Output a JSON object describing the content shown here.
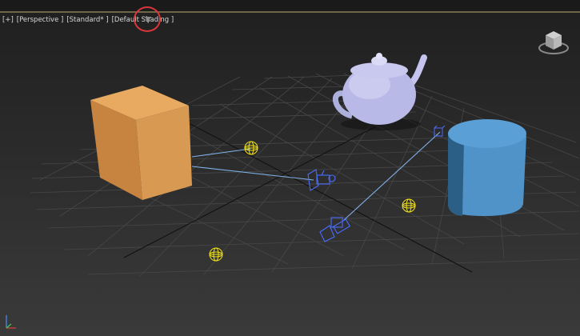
{
  "viewport": {
    "labels": {
      "menu": "[+]",
      "view": "[Perspective ]",
      "preset": "[Standard* ]",
      "shading": "[Default Shading ]"
    },
    "icons": {
      "filter": "filter-icon",
      "viewcube": "viewcube-icon",
      "axis": "axis-tripod-icon"
    },
    "colors": {
      "background": "#2b2b2b",
      "grid": "#4a4a4a",
      "box": "#d89a52",
      "teapot": "#b9b9e8",
      "cylinder": "#4f93c8",
      "omni_light": "#f2e21a",
      "camera": "#4a6dff",
      "highlight_ring": "#d7363a",
      "active_border": "#6e6546"
    }
  }
}
